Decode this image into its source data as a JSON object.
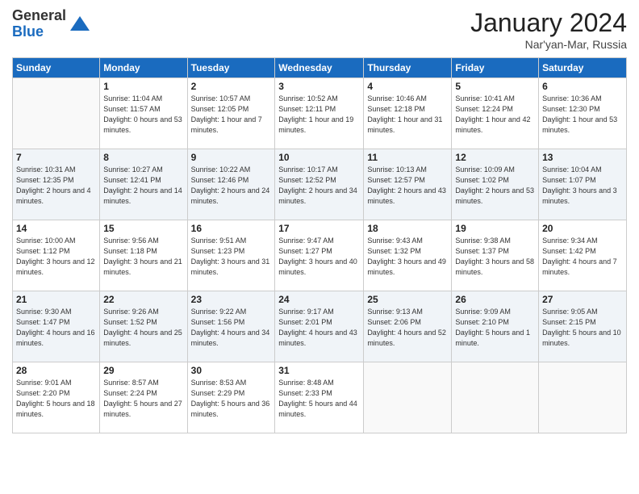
{
  "header": {
    "logo_general": "General",
    "logo_blue": "Blue",
    "month_title": "January 2024",
    "location": "Nar'yan-Mar, Russia"
  },
  "days_of_week": [
    "Sunday",
    "Monday",
    "Tuesday",
    "Wednesday",
    "Thursday",
    "Friday",
    "Saturday"
  ],
  "weeks": [
    [
      {
        "day": "",
        "sunrise": "",
        "sunset": "",
        "daylight": ""
      },
      {
        "day": "1",
        "sunrise": "Sunrise: 11:04 AM",
        "sunset": "Sunset: 11:57 AM",
        "daylight": "Daylight: 0 hours and 53 minutes."
      },
      {
        "day": "2",
        "sunrise": "Sunrise: 10:57 AM",
        "sunset": "Sunset: 12:05 PM",
        "daylight": "Daylight: 1 hour and 7 minutes."
      },
      {
        "day": "3",
        "sunrise": "Sunrise: 10:52 AM",
        "sunset": "Sunset: 12:11 PM",
        "daylight": "Daylight: 1 hour and 19 minutes."
      },
      {
        "day": "4",
        "sunrise": "Sunrise: 10:46 AM",
        "sunset": "Sunset: 12:18 PM",
        "daylight": "Daylight: 1 hour and 31 minutes."
      },
      {
        "day": "5",
        "sunrise": "Sunrise: 10:41 AM",
        "sunset": "Sunset: 12:24 PM",
        "daylight": "Daylight: 1 hour and 42 minutes."
      },
      {
        "day": "6",
        "sunrise": "Sunrise: 10:36 AM",
        "sunset": "Sunset: 12:30 PM",
        "daylight": "Daylight: 1 hour and 53 minutes."
      }
    ],
    [
      {
        "day": "7",
        "sunrise": "Sunrise: 10:31 AM",
        "sunset": "Sunset: 12:35 PM",
        "daylight": "Daylight: 2 hours and 4 minutes."
      },
      {
        "day": "8",
        "sunrise": "Sunrise: 10:27 AM",
        "sunset": "Sunset: 12:41 PM",
        "daylight": "Daylight: 2 hours and 14 minutes."
      },
      {
        "day": "9",
        "sunrise": "Sunrise: 10:22 AM",
        "sunset": "Sunset: 12:46 PM",
        "daylight": "Daylight: 2 hours and 24 minutes."
      },
      {
        "day": "10",
        "sunrise": "Sunrise: 10:17 AM",
        "sunset": "Sunset: 12:52 PM",
        "daylight": "Daylight: 2 hours and 34 minutes."
      },
      {
        "day": "11",
        "sunrise": "Sunrise: 10:13 AM",
        "sunset": "Sunset: 12:57 PM",
        "daylight": "Daylight: 2 hours and 43 minutes."
      },
      {
        "day": "12",
        "sunrise": "Sunrise: 10:09 AM",
        "sunset": "Sunset: 1:02 PM",
        "daylight": "Daylight: 2 hours and 53 minutes."
      },
      {
        "day": "13",
        "sunrise": "Sunrise: 10:04 AM",
        "sunset": "Sunset: 1:07 PM",
        "daylight": "Daylight: 3 hours and 3 minutes."
      }
    ],
    [
      {
        "day": "14",
        "sunrise": "Sunrise: 10:00 AM",
        "sunset": "Sunset: 1:12 PM",
        "daylight": "Daylight: 3 hours and 12 minutes."
      },
      {
        "day": "15",
        "sunrise": "Sunrise: 9:56 AM",
        "sunset": "Sunset: 1:18 PM",
        "daylight": "Daylight: 3 hours and 21 minutes."
      },
      {
        "day": "16",
        "sunrise": "Sunrise: 9:51 AM",
        "sunset": "Sunset: 1:23 PM",
        "daylight": "Daylight: 3 hours and 31 minutes."
      },
      {
        "day": "17",
        "sunrise": "Sunrise: 9:47 AM",
        "sunset": "Sunset: 1:27 PM",
        "daylight": "Daylight: 3 hours and 40 minutes."
      },
      {
        "day": "18",
        "sunrise": "Sunrise: 9:43 AM",
        "sunset": "Sunset: 1:32 PM",
        "daylight": "Daylight: 3 hours and 49 minutes."
      },
      {
        "day": "19",
        "sunrise": "Sunrise: 9:38 AM",
        "sunset": "Sunset: 1:37 PM",
        "daylight": "Daylight: 3 hours and 58 minutes."
      },
      {
        "day": "20",
        "sunrise": "Sunrise: 9:34 AM",
        "sunset": "Sunset: 1:42 PM",
        "daylight": "Daylight: 4 hours and 7 minutes."
      }
    ],
    [
      {
        "day": "21",
        "sunrise": "Sunrise: 9:30 AM",
        "sunset": "Sunset: 1:47 PM",
        "daylight": "Daylight: 4 hours and 16 minutes."
      },
      {
        "day": "22",
        "sunrise": "Sunrise: 9:26 AM",
        "sunset": "Sunset: 1:52 PM",
        "daylight": "Daylight: 4 hours and 25 minutes."
      },
      {
        "day": "23",
        "sunrise": "Sunrise: 9:22 AM",
        "sunset": "Sunset: 1:56 PM",
        "daylight": "Daylight: 4 hours and 34 minutes."
      },
      {
        "day": "24",
        "sunrise": "Sunrise: 9:17 AM",
        "sunset": "Sunset: 2:01 PM",
        "daylight": "Daylight: 4 hours and 43 minutes."
      },
      {
        "day": "25",
        "sunrise": "Sunrise: 9:13 AM",
        "sunset": "Sunset: 2:06 PM",
        "daylight": "Daylight: 4 hours and 52 minutes."
      },
      {
        "day": "26",
        "sunrise": "Sunrise: 9:09 AM",
        "sunset": "Sunset: 2:10 PM",
        "daylight": "Daylight: 5 hours and 1 minute."
      },
      {
        "day": "27",
        "sunrise": "Sunrise: 9:05 AM",
        "sunset": "Sunset: 2:15 PM",
        "daylight": "Daylight: 5 hours and 10 minutes."
      }
    ],
    [
      {
        "day": "28",
        "sunrise": "Sunrise: 9:01 AM",
        "sunset": "Sunset: 2:20 PM",
        "daylight": "Daylight: 5 hours and 18 minutes."
      },
      {
        "day": "29",
        "sunrise": "Sunrise: 8:57 AM",
        "sunset": "Sunset: 2:24 PM",
        "daylight": "Daylight: 5 hours and 27 minutes."
      },
      {
        "day": "30",
        "sunrise": "Sunrise: 8:53 AM",
        "sunset": "Sunset: 2:29 PM",
        "daylight": "Daylight: 5 hours and 36 minutes."
      },
      {
        "day": "31",
        "sunrise": "Sunrise: 8:48 AM",
        "sunset": "Sunset: 2:33 PM",
        "daylight": "Daylight: 5 hours and 44 minutes."
      },
      {
        "day": "",
        "sunrise": "",
        "sunset": "",
        "daylight": ""
      },
      {
        "day": "",
        "sunrise": "",
        "sunset": "",
        "daylight": ""
      },
      {
        "day": "",
        "sunrise": "",
        "sunset": "",
        "daylight": ""
      }
    ]
  ]
}
